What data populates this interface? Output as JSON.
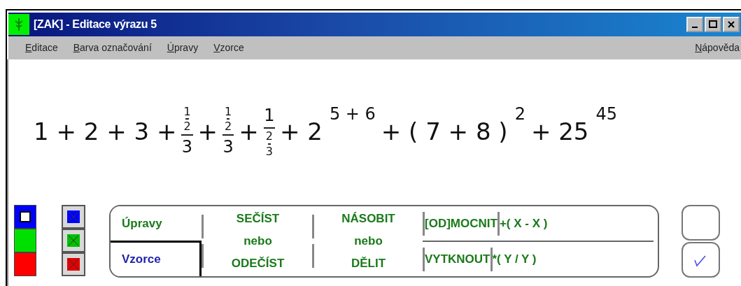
{
  "window": {
    "title": "[ZAK] - Editace výrazu 5"
  },
  "menu": [
    {
      "label": "Editace",
      "underline_first": true
    },
    {
      "label": "Barva označování",
      "underline_first": true
    },
    {
      "label": "Úpravy",
      "underline_first": true
    },
    {
      "label": "Vzorce",
      "underline_first": true
    }
  ],
  "help_menu": {
    "label": "Nápověda",
    "underline_first": true
  },
  "expression": [
    {
      "kind": "text",
      "text": "1 + 2 + 3 +"
    },
    {
      "kind": "frac",
      "numerator": [
        {
          "kind": "frac",
          "numerator": [
            {
              "kind": "text",
              "text": "1"
            }
          ],
          "denominator": [
            {
              "kind": "text",
              "text": "2"
            }
          ]
        }
      ],
      "denominator": [
        {
          "kind": "text",
          "text": "3"
        }
      ]
    },
    {
      "kind": "text",
      "text": "+"
    },
    {
      "kind": "frac",
      "numerator": [
        {
          "kind": "frac",
          "numerator": [
            {
              "kind": "text",
              "text": "1"
            }
          ],
          "denominator": [
            {
              "kind": "text",
              "text": "2"
            }
          ]
        }
      ],
      "denominator": [
        {
          "kind": "text",
          "text": "3"
        }
      ]
    },
    {
      "kind": "text",
      "text": "+"
    },
    {
      "kind": "frac",
      "numerator": [
        {
          "kind": "text",
          "text": "1"
        }
      ],
      "denominator": [
        {
          "kind": "frac",
          "numerator": [
            {
              "kind": "text",
              "text": "2"
            }
          ],
          "denominator": [
            {
              "kind": "text",
              "text": "3"
            }
          ]
        }
      ]
    },
    {
      "kind": "text",
      "text": "+ 2"
    },
    {
      "kind": "sup",
      "text": "5 + 6"
    },
    {
      "kind": "text",
      "text": "+ ( 7 + 8 )"
    },
    {
      "kind": "sup",
      "text": "2"
    },
    {
      "kind": "text",
      "text": "+ 25"
    },
    {
      "kind": "sup",
      "text": "45"
    }
  ],
  "highlight_colors": [
    {
      "color": "#0000ff",
      "selected": true
    },
    {
      "color": "#00e000",
      "selected": false
    },
    {
      "color": "#ff0000",
      "selected": false
    }
  ],
  "color_toggles": [
    {
      "color": "#0000ff"
    },
    {
      "color": "#00c000"
    },
    {
      "color": "#e00000"
    }
  ],
  "tabs": [
    {
      "label": "Úpravy",
      "selected": true
    },
    {
      "label": "Vzorce",
      "selected": false
    }
  ],
  "operations": [
    {
      "kind": "stacked",
      "top": "SEČÍST",
      "middle": "nebo",
      "bottom": "ODEČÍST"
    },
    {
      "kind": "stacked",
      "top": "NÁSOBIT",
      "middle": "nebo",
      "bottom": "DĚLIT"
    },
    {
      "kind": "pair",
      "top": "[OD]MOCNIT",
      "bottom": "VYTKNOUT"
    },
    {
      "kind": "pair",
      "top": "+( X - X )",
      "bottom": "*( Y / Y )"
    }
  ],
  "side_buttons": [
    {
      "kind": "blank"
    },
    {
      "kind": "check"
    }
  ]
}
